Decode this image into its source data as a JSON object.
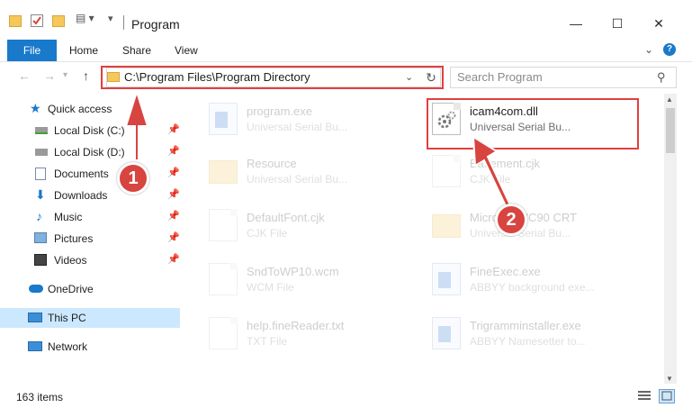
{
  "window": {
    "title": "Program",
    "minimize_icon": "minimize-icon",
    "maximize_icon": "maximize-icon",
    "close_icon": "close-icon"
  },
  "ribbon": {
    "tabs": [
      "File",
      "Home",
      "Share",
      "View"
    ]
  },
  "nav": {
    "address": "C:\\Program Files\\Program Directory",
    "search_placeholder": "Search Program"
  },
  "sidebar": {
    "items": [
      {
        "label": "Quick access",
        "icon": "star-icon",
        "pinned": false
      },
      {
        "label": "Local Disk (C:)",
        "icon": "drive-icon",
        "pinned": true
      },
      {
        "label": "Local Disk (D:)",
        "icon": "drive-icon",
        "pinned": true
      },
      {
        "label": "Documents",
        "icon": "documents-icon",
        "pinned": true
      },
      {
        "label": "Downloads",
        "icon": "download-icon",
        "pinned": true
      },
      {
        "label": "Music",
        "icon": "music-icon",
        "pinned": true
      },
      {
        "label": "Pictures",
        "icon": "pictures-icon",
        "pinned": true
      },
      {
        "label": "Videos",
        "icon": "videos-icon",
        "pinned": true
      },
      {
        "label": "OneDrive",
        "icon": "cloud-icon",
        "pinned": false
      },
      {
        "label": "This PC",
        "icon": "computer-icon",
        "pinned": false
      },
      {
        "label": "Network",
        "icon": "network-icon",
        "pinned": false
      }
    ]
  },
  "files": [
    {
      "name": "program.exe",
      "type": "Universal Serial Bu...",
      "icon": "exe-icon"
    },
    {
      "name": "icam4com.dll",
      "type": "Universal Serial Bu...",
      "icon": "gear-file-icon"
    },
    {
      "name": "Resource",
      "type": "Universal Serial Bu...",
      "icon": "folder-icon"
    },
    {
      "name": "Basement.cjk",
      "type": "CJK File",
      "icon": "file-icon"
    },
    {
      "name": "DefaultFont.cjk",
      "type": "CJK File",
      "icon": "file-icon"
    },
    {
      "name": "Microsoft VC90 CRT",
      "type": "Universal Serial Bu...",
      "icon": "folder-icon"
    },
    {
      "name": "SndToWP10.wcm",
      "type": "WCM File",
      "icon": "file-icon"
    },
    {
      "name": "FineExec.exe",
      "type": "ABBYY background exe...",
      "icon": "exe-icon"
    },
    {
      "name": "help.fineReader.txt",
      "type": "TXT File",
      "icon": "file-icon"
    },
    {
      "name": "Trigramminstaller.exe",
      "type": "ABBYY Namesetter to...",
      "icon": "exe-icon"
    }
  ],
  "status": {
    "count": "163 items"
  },
  "annotations": {
    "step1": "1",
    "step2": "2",
    "color": "#d8443f"
  }
}
